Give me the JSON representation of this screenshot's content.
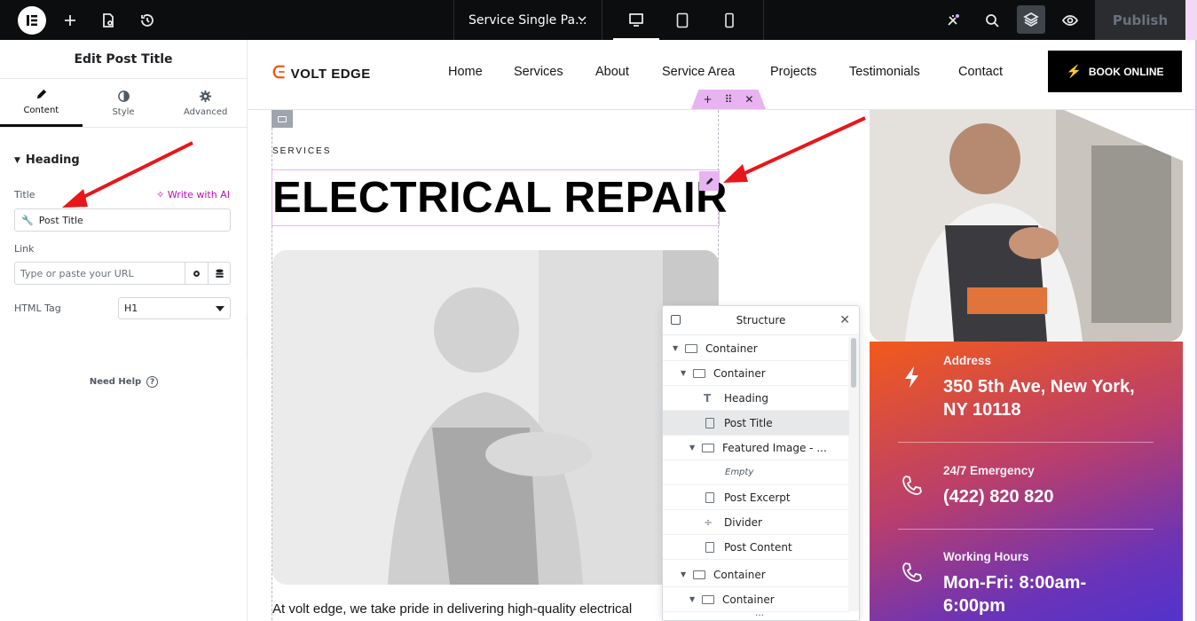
{
  "topbar": {
    "document_title": "Service Single Pa...",
    "publish_label": "Publish",
    "icons": [
      "elementor-logo-icon",
      "plus-icon",
      "page-settings-icon",
      "history-icon",
      "desktop-icon",
      "tablet-icon",
      "mobile-icon",
      "notifications-icon",
      "search-icon",
      "layers-icon",
      "preview-eye-icon"
    ]
  },
  "panel": {
    "title": "Edit Post Title",
    "tabs": [
      {
        "label": "Content"
      },
      {
        "label": "Style"
      },
      {
        "label": "Advanced"
      }
    ],
    "section": "Heading",
    "title_label": "Title",
    "ai_link": "Write with AI",
    "title_value": "Post Title",
    "link_label": "Link",
    "link_placeholder": "Type or paste your URL",
    "html_tag_label": "HTML Tag",
    "html_tag_value": "H1",
    "need_help": "Need Help"
  },
  "site": {
    "logo_text": "VOLT EDGE",
    "nav": [
      "Home",
      "Services",
      "About",
      "Service Area",
      "Projects",
      "Testimonials",
      "Contact"
    ],
    "book_button": "BOOK ONLINE",
    "services_label": "SERVICES",
    "post_title": "ELECTRICAL REPAIR",
    "excerpt": "At volt edge, we take pride in delivering high-quality electrical",
    "info": [
      {
        "label": "Address",
        "value_line1": "350 5th Ave, New York,",
        "value_line2": "NY 10118"
      },
      {
        "label": "24/7 Emergency",
        "value_line1": "(422) 820 820",
        "value_line2": ""
      },
      {
        "label": "Working Hours",
        "value_line1": "Mon-Fri: 8:00am-",
        "value_line2": "6:00pm"
      }
    ]
  },
  "structure": {
    "title": "Structure",
    "items": [
      {
        "label": "Container"
      },
      {
        "label": "Container"
      },
      {
        "label": "Heading"
      },
      {
        "label": "Post Title"
      },
      {
        "label": "Featured Image - ..."
      },
      {
        "label": "Empty"
      },
      {
        "label": "Post Excerpt"
      },
      {
        "label": "Divider"
      },
      {
        "label": "Post Content"
      },
      {
        "label": "Container"
      },
      {
        "label": "Container"
      }
    ]
  },
  "colors": {
    "accent": "#f05a1a",
    "selection": "#e8b3f1",
    "ai": "#c00bb9",
    "gradient_start": "#f25a1b",
    "gradient_end": "#4e33cf"
  }
}
